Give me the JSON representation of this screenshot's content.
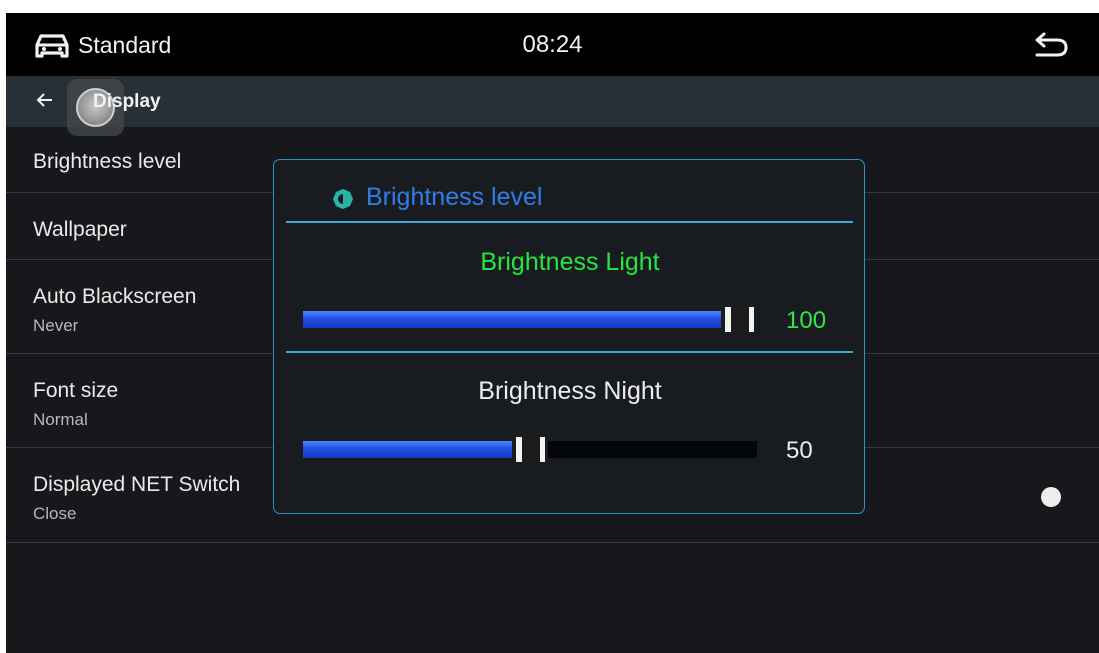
{
  "status_bar": {
    "mode_label": "Standard",
    "mode_icon": "car-icon",
    "time": "08:24",
    "back_icon": "return-icon"
  },
  "nav": {
    "back_icon": "arrow-left-icon",
    "title": "Display"
  },
  "settings": [
    {
      "label": "Brightness level",
      "sub": ""
    },
    {
      "label": "Wallpaper",
      "sub": ""
    },
    {
      "label": "Auto Blackscreen",
      "sub": "Never"
    },
    {
      "label": "Font size",
      "sub": "Normal"
    },
    {
      "label": "Displayed NET Switch",
      "sub": "Close",
      "toggle_on": false
    }
  ],
  "dialog": {
    "title": "Brightness level",
    "icon": "brightness-icon",
    "light": {
      "label": "Brightness Light",
      "value": "100",
      "level": 1.0
    },
    "night": {
      "label": "Brightness Night",
      "value": "50",
      "level": 0.5
    }
  },
  "colors": {
    "accent_blue": "#2e7ee8",
    "light_green": "#28e53c",
    "slider_fill": "#1f4fe2",
    "dialog_border": "#2a93c9"
  }
}
